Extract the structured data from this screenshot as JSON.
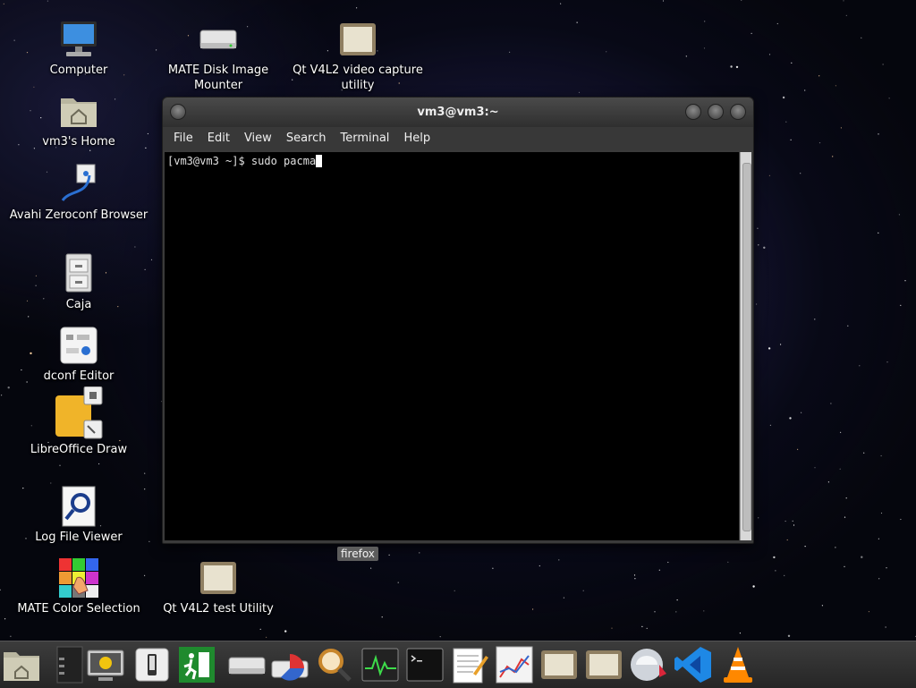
{
  "desktop": {
    "icons": [
      {
        "label": "Computer",
        "icon": "computer-icon"
      },
      {
        "label": "vm3's Home",
        "icon": "home-folder-icon"
      },
      {
        "label": "Avahi Zeroconf Browser",
        "icon": "network-icon"
      },
      {
        "label": "Caja",
        "icon": "file-cabinet-icon"
      },
      {
        "label": "dconf Editor",
        "icon": "settings-editor-icon"
      },
      {
        "label": "LibreOffice Draw",
        "icon": "draw-app-icon"
      },
      {
        "label": "Log File Viewer",
        "icon": "log-viewer-icon"
      },
      {
        "label": "MATE Color Selection",
        "icon": "color-selection-icon"
      },
      {
        "label": "MATE Disk Image Mounter",
        "icon": "disk-drive-icon"
      },
      {
        "label": "Qt V4L2 video capture utility",
        "icon": "generic-app-icon"
      },
      {
        "label": "Qt V4L2 test Utility",
        "icon": "generic-app-icon"
      }
    ]
  },
  "terminal": {
    "title": "vm3@vm3:~",
    "menu": [
      "File",
      "Edit",
      "View",
      "Search",
      "Terminal",
      "Help"
    ],
    "prompt": "[vm3@vm3 ~]$ ",
    "command": "sudo pacma"
  },
  "tooltip": {
    "text": "firefox"
  },
  "panel": {
    "launchers": [
      "home-folder-icon",
      "workspace-switcher-icon",
      "system-monitor-screen-icon",
      "device-icon",
      "exit-icon",
      "disk-drive-icon",
      "disk-usage-icon",
      "search-magnifier-icon",
      "system-monitor-icon",
      "terminal-icon",
      "text-editor-icon",
      "chart-app-icon",
      "generic-app-icon",
      "generic-app-icon",
      "firefox-icon",
      "vscode-icon",
      "vlc-icon"
    ]
  },
  "colors": {
    "terminal_bg": "#000000",
    "window_chrome": "#3b3b3b",
    "panel_bg": "#2e2e2e"
  }
}
